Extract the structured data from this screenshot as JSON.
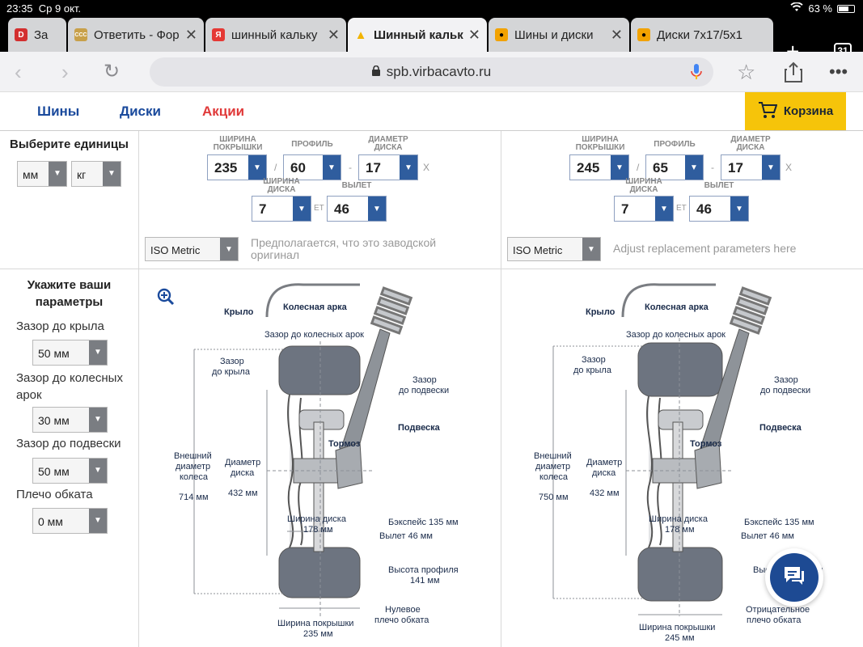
{
  "status": {
    "time": "23:35",
    "date": "Ср 9 окт.",
    "battery": "63 %"
  },
  "tabs": [
    {
      "label": "За",
      "favicon": "D",
      "color": "#d32f2f"
    },
    {
      "label": "Ответить - Фор",
      "favicon": "CCC",
      "color": "#c8a04a"
    },
    {
      "label": "шинный кальку",
      "favicon": "Я",
      "color": "#e53935"
    },
    {
      "label": "Шинный кальк",
      "favicon": "▲",
      "color": "#f2b400"
    },
    {
      "label": "Шины и диски",
      "favicon": "●",
      "color": "#f2a200"
    },
    {
      "label": "Диски 7x17/5x1",
      "favicon": "●",
      "color": "#f2a200"
    }
  ],
  "tab_count": "31",
  "url": "spb.virbacavto.ru",
  "nav": {
    "tires": "Шины",
    "disks": "Диски",
    "promo": "Акции",
    "cart": "Корзина"
  },
  "units": {
    "title": "Выберите единицы",
    "length": "мм",
    "weight": "кг"
  },
  "caps": {
    "width": "ШИРИНА ПОКРЫШКИ",
    "profile": "ПРОФИЛЬ",
    "diameter": "ДИАМЕТР ДИСКА",
    "disk_width": "ШИРИНА ДИСКА",
    "offset": "ВЫЛЕТ",
    "et": "ET",
    "slash": "/",
    "dash": "-",
    "x": "X"
  },
  "original": {
    "width": "235",
    "profile": "60",
    "diameter": "17",
    "disk_width": "7",
    "offset": "46",
    "iso": "ISO Metric",
    "note": "Предполагается, что это заводской оригинал"
  },
  "replacement": {
    "width": "245",
    "profile": "65",
    "diameter": "17",
    "disk_width": "7",
    "offset": "46",
    "iso": "ISO Metric",
    "note": "Adjust replacement parameters here"
  },
  "params": {
    "title": "Укажите ваши параметры",
    "fender_label": "Зазор до крыла",
    "fender": "50 мм",
    "arch_label": "Зазор до колесных арок",
    "arch": "30 мм",
    "susp_label": "Зазор до подвески",
    "susp": "50 мм",
    "shoulder_label": "Плечо обката",
    "shoulder": "0 мм"
  },
  "diagram": {
    "fender": "Крыло",
    "arch": "Колесная арка",
    "arch_gap": "Зазор до колесных арок",
    "fender_gap": "Зазор",
    "fender_gap2": "до крыла",
    "susp_gap": "Зазор",
    "susp_gap2": "до подвески",
    "suspension": "Подвеска",
    "brake": "Тормоз",
    "outer1": "Внешний",
    "outer2": "диаметр",
    "outer3": "колеса",
    "rim1": "Диаметр",
    "rim2": "диска",
    "rim_val": "432 мм",
    "disk_w": "Ширина диска",
    "disk_w_val": "178 мм",
    "backspace": "Бэкспейс 135 мм",
    "offset": "Вылет 46 мм",
    "profile_h": "Высота профиля",
    "tire_w": "Ширина покрышки",
    "shoulder0a": "Нулевое",
    "shoulder0b": "плечо обката",
    "shoulderNa": "Отрицательное",
    "shoulderNb": "плечо обката"
  },
  "diag_left": {
    "outer_val": "714 мм",
    "profile_val": "141 мм",
    "tire_w_val": "235 мм"
  },
  "diag_right": {
    "outer_val": "750 мм",
    "profile_val": "Высота профиля",
    "tire_w_val": "245 мм"
  },
  "colors": {
    "brand": "#1a4a9c",
    "accent": "#f6c40a",
    "promo": "#e03a3a",
    "select_arrow": "#2f5d9e"
  }
}
